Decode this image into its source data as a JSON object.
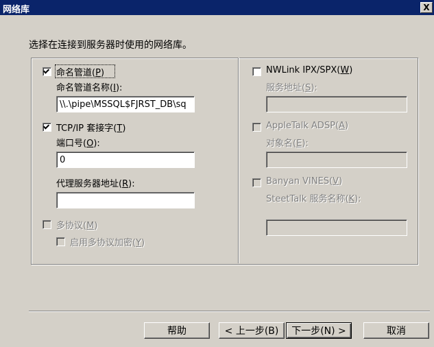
{
  "window": {
    "title": "网络库",
    "close_glyph": "X"
  },
  "prompt": "选择在连接到服务器时使用的网络库。",
  "left": {
    "named_pipes": {
      "label_text": "命名管道",
      "hotkey": "P",
      "checked": true,
      "name_label_text": "命名管道名称",
      "name_hotkey": "I",
      "name_value": "\\\\.\\pipe\\MSSQL$FJRST_DB\\sq"
    },
    "tcpip": {
      "label_text": "TCP/IP 套接字",
      "hotkey": "T",
      "checked": true,
      "port_label_text": "端口号",
      "port_hotkey": "O",
      "port_value": "0",
      "proxy_label_text": "代理服务器地址",
      "proxy_hotkey": "R",
      "proxy_value": ""
    },
    "multiprotocol": {
      "label_text": "多协议",
      "hotkey": "M",
      "checked": false,
      "encrypt_label_text": "启用多协议加密",
      "encrypt_hotkey": "Y",
      "encrypt_checked": false
    }
  },
  "right": {
    "nwlink": {
      "label_text": "NWLink IPX/SPX",
      "hotkey": "W",
      "checked": false,
      "addr_label_text": "服务地址",
      "addr_hotkey": "S",
      "addr_value": ""
    },
    "appletalk": {
      "label_text": "AppleTalk ADSP",
      "hotkey": "A",
      "checked": false,
      "obj_label_text": "对象名",
      "obj_hotkey": "E",
      "obj_value": ""
    },
    "banyan": {
      "label_text": "Banyan VINES",
      "hotkey": "V",
      "checked": false,
      "svc_label_text": "SteetTalk 服务名称",
      "svc_hotkey": "K",
      "svc_value": ""
    }
  },
  "buttons": {
    "help": "帮助",
    "back": "< 上一步(B)",
    "next": "下一步(N) >",
    "cancel": "取消"
  }
}
